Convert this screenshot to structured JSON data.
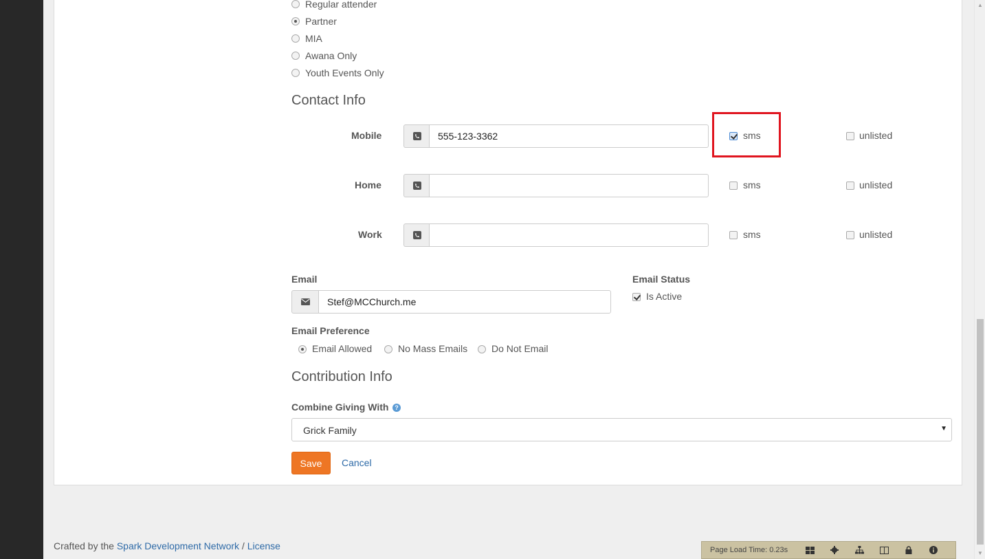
{
  "status_radios": [
    {
      "label": "Regular attender",
      "checked": false
    },
    {
      "label": "Partner",
      "checked": true
    },
    {
      "label": "MIA",
      "checked": false
    },
    {
      "label": "Awana Only",
      "checked": false
    },
    {
      "label": "Youth Events Only",
      "checked": false
    }
  ],
  "contact": {
    "title": "Contact Info",
    "phones": [
      {
        "label": "Mobile",
        "value": "555-123-3362",
        "sms": true,
        "unlisted": false
      },
      {
        "label": "Home",
        "value": "",
        "sms": false,
        "unlisted": false
      },
      {
        "label": "Work",
        "value": "",
        "sms": false,
        "unlisted": false
      }
    ],
    "sms_label": "sms",
    "unlisted_label": "unlisted",
    "email_label": "Email",
    "email_value": "Stef@MCChurch.me",
    "email_status_label": "Email Status",
    "is_active_label": "Is Active",
    "is_active": true,
    "email_pref_label": "Email Preference",
    "email_prefs": [
      {
        "label": "Email Allowed",
        "checked": true
      },
      {
        "label": "No Mass Emails",
        "checked": false
      },
      {
        "label": "Do Not Email",
        "checked": false
      }
    ]
  },
  "contribution": {
    "title": "Contribution Info",
    "combine_label": "Combine Giving With",
    "combine_value": "Grick Family"
  },
  "actions": {
    "save": "Save",
    "cancel": "Cancel"
  },
  "footer": {
    "crafted": "Crafted by the",
    "network": "Spark Development Network",
    "sep": "/",
    "license": "License"
  },
  "admin_bar": {
    "load_time": "Page Load Time: 0.23s"
  },
  "colors": {
    "accent": "#ee7624",
    "link": "#2e6aa7",
    "highlight": "#e0151f"
  }
}
